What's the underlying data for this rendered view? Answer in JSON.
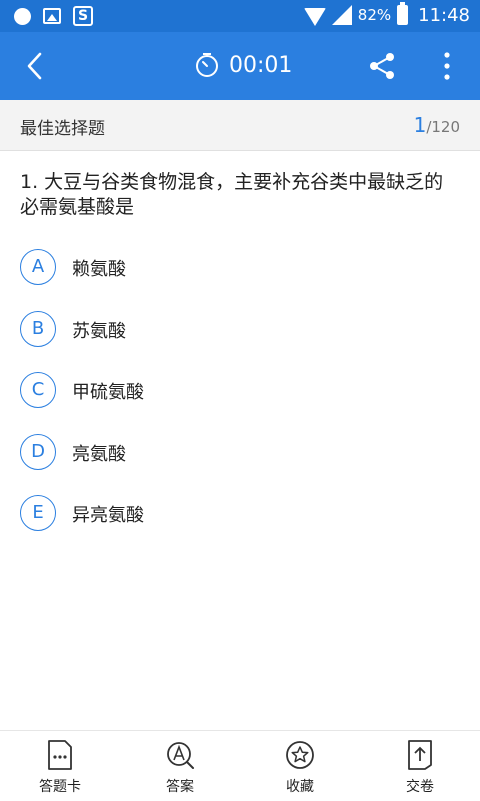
{
  "status_bar": {
    "battery_percent": "82%",
    "time": "11:48",
    "icons": [
      "notification-dot-icon",
      "image-icon",
      "s-app-icon",
      "wifi-icon",
      "signal-icon",
      "battery-icon"
    ]
  },
  "app_bar": {
    "timer": "00:01",
    "icons": [
      "back-arrow-icon",
      "stopwatch-icon",
      "share-icon",
      "more-vert-icon"
    ]
  },
  "section": {
    "title": "最佳选择题",
    "current": "1",
    "total": "/120"
  },
  "question": {
    "text": "1. 大豆与谷类食物混食，主要补充谷类中最缺乏的必需氨基酸是"
  },
  "options": [
    {
      "letter": "A",
      "text": "赖氨酸"
    },
    {
      "letter": "B",
      "text": "苏氨酸"
    },
    {
      "letter": "C",
      "text": "甲硫氨酸"
    },
    {
      "letter": "D",
      "text": "亮氨酸"
    },
    {
      "letter": "E",
      "text": "异亮氨酸"
    }
  ],
  "bottom_nav": [
    {
      "label": "答题卡",
      "icon": "answer-card-icon"
    },
    {
      "label": "答案",
      "icon": "answer-search-icon"
    },
    {
      "label": "收藏",
      "icon": "star-icon"
    },
    {
      "label": "交卷",
      "icon": "submit-icon"
    }
  ],
  "colors": {
    "status_bar": "#1f73d2",
    "app_bar": "#2b7fe0",
    "accent": "#2b7fe0"
  }
}
